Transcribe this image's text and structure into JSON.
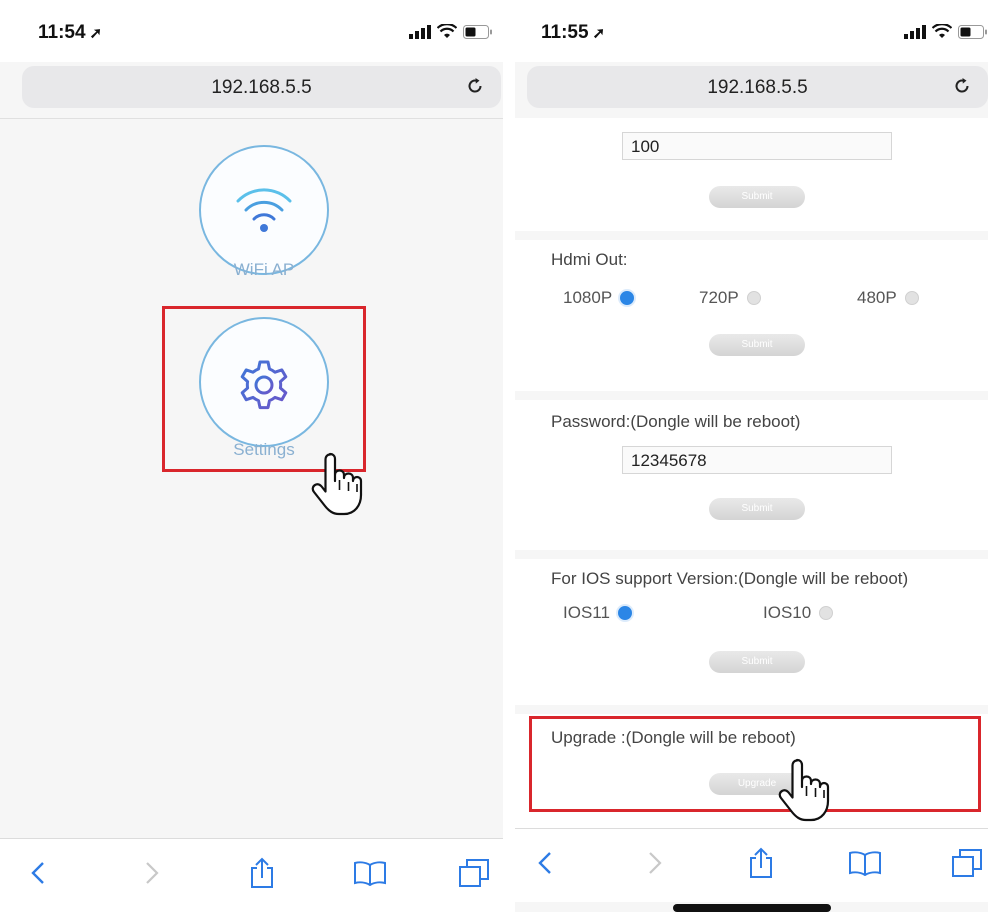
{
  "left": {
    "time": "11:54",
    "url": "192.168.5.5",
    "wifi_label": "WiFi AP",
    "settings_label": "Settings"
  },
  "right": {
    "time": "11:55",
    "url": "192.168.5.5",
    "top_field_value": "100",
    "submit_label": "Submit",
    "hdmi": {
      "label": "Hdmi Out:",
      "options": [
        {
          "label": "1080P",
          "selected": true
        },
        {
          "label": "720P",
          "selected": false
        },
        {
          "label": "480P",
          "selected": false
        }
      ]
    },
    "password": {
      "label": "Password:(Dongle will be reboot)",
      "value": "12345678"
    },
    "ios": {
      "label": "For IOS support Version:(Dongle will be reboot)",
      "options": [
        {
          "label": "IOS11",
          "selected": true
        },
        {
          "label": "IOS10",
          "selected": false
        }
      ]
    },
    "upgrade": {
      "label": "Upgrade :(Dongle will be reboot)",
      "button_label": "Upgrade"
    }
  },
  "colors": {
    "highlight": "#d9262c",
    "accent_blue": "#2b86e6",
    "circle_border": "#79b7e0",
    "icon_blue": "#3f78d8"
  },
  "icons": {
    "status": [
      "location-arrow-icon",
      "signal-icon",
      "wifi-icon",
      "battery-icon"
    ],
    "toolbar": [
      "back-icon",
      "forward-icon",
      "share-icon",
      "bookmarks-icon",
      "tabs-icon"
    ],
    "other": [
      "reload-icon",
      "wifi-ap-icon",
      "gear-icon",
      "hand-pointer-icon"
    ]
  }
}
